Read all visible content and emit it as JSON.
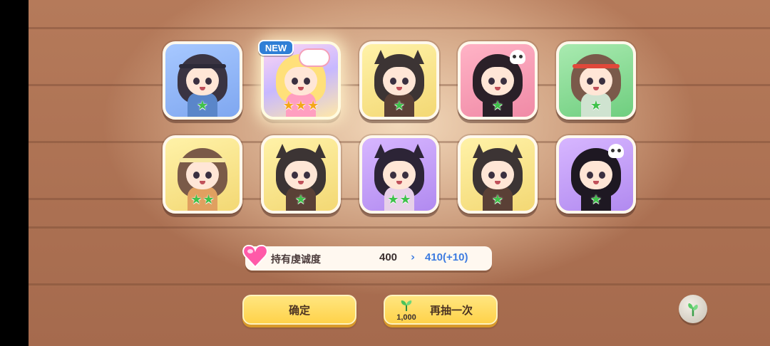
{
  "cards": [
    {
      "color": "blue",
      "stars": 1,
      "star_color": "green",
      "hair": "#3a3442",
      "body": "#5a86c9",
      "feature": "headband"
    },
    {
      "color": "rainbow",
      "stars": 3,
      "star_color": "gold",
      "hair": "#ffe07a",
      "body": "#ff9fc0",
      "feature": "hood",
      "is_new": true
    },
    {
      "color": "yellow",
      "stars": 1,
      "star_color": "green",
      "hair": "#3c3434",
      "body": "#5a4036",
      "feature": "wolf"
    },
    {
      "color": "pink",
      "stars": 1,
      "star_color": "green",
      "hair": "#2a2028",
      "body": "#2a2028",
      "feature": "skull"
    },
    {
      "color": "green",
      "stars": 1,
      "star_color": "green",
      "hair": "#7a5a4a",
      "body": "#cfe3d0",
      "feature": "headband-red"
    },
    {
      "color": "yellow",
      "stars": 2,
      "star_color": "green",
      "hair": "#7a5a48",
      "body": "#e0a060",
      "feature": "headband-yellow"
    },
    {
      "color": "yellow",
      "stars": 1,
      "star_color": "green",
      "hair": "#3c3434",
      "body": "#5a4036",
      "feature": "wolf"
    },
    {
      "color": "purple",
      "stars": 2,
      "star_color": "green",
      "hair": "#2c2436",
      "body": "#e7d0e8",
      "feature": "dog"
    },
    {
      "color": "yellow",
      "stars": 1,
      "star_color": "green",
      "hair": "#3c3434",
      "body": "#5a4036",
      "feature": "wolf"
    },
    {
      "color": "purple",
      "stars": 1,
      "star_color": "green",
      "hair": "#1e1822",
      "body": "#1e1822",
      "feature": "skull"
    }
  ],
  "new_badge": "NEW",
  "loyalty": {
    "label": "持有虔诚度",
    "current": "400",
    "arrow": "›",
    "next": "410(+10)"
  },
  "buttons": {
    "confirm": "确定",
    "redraw": "再抽一次",
    "redraw_cost": "1,000"
  }
}
